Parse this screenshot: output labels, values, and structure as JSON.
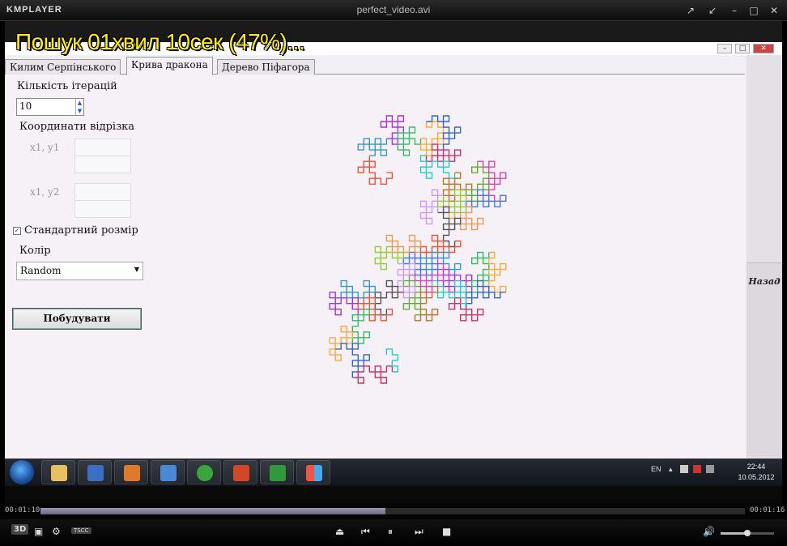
{
  "player": {
    "logo": "KMPLAYER",
    "window_title": "perfect_video.avi",
    "osd_text": "Пошук 01хвил 10сек (47%)...",
    "time_elapsed": "00:01:10",
    "time_total": "00:01:16",
    "progress_fraction": 0.49,
    "volume_fraction": 0.5,
    "badges": {
      "three_d": "3D",
      "tscc": "TSCC"
    },
    "window_buttons": [
      "pin-icon",
      "restore-icon",
      "minimize-icon",
      "maximize-icon",
      "close-icon"
    ]
  },
  "app": {
    "tabs": [
      {
        "label": "Килим Серпінського",
        "active": false
      },
      {
        "label": "Крива дракона",
        "active": true
      },
      {
        "label": "Дерево Піфагора",
        "active": false
      }
    ],
    "iterations_label": "Кількість ітерацій",
    "iterations_value": "10",
    "coords_label": "Координати відрізка",
    "x1y1_label": "x1, y1",
    "x1y2_label": "x1, y2",
    "standard_size_label": "Стандартний розмір",
    "standard_size_checked": true,
    "color_label": "Колір",
    "color_value": "Random",
    "build_button": "Побудувати",
    "back_button": "Назад"
  },
  "taskbar": {
    "language": "EN",
    "time": "22:44",
    "date": "10.05.2012"
  }
}
